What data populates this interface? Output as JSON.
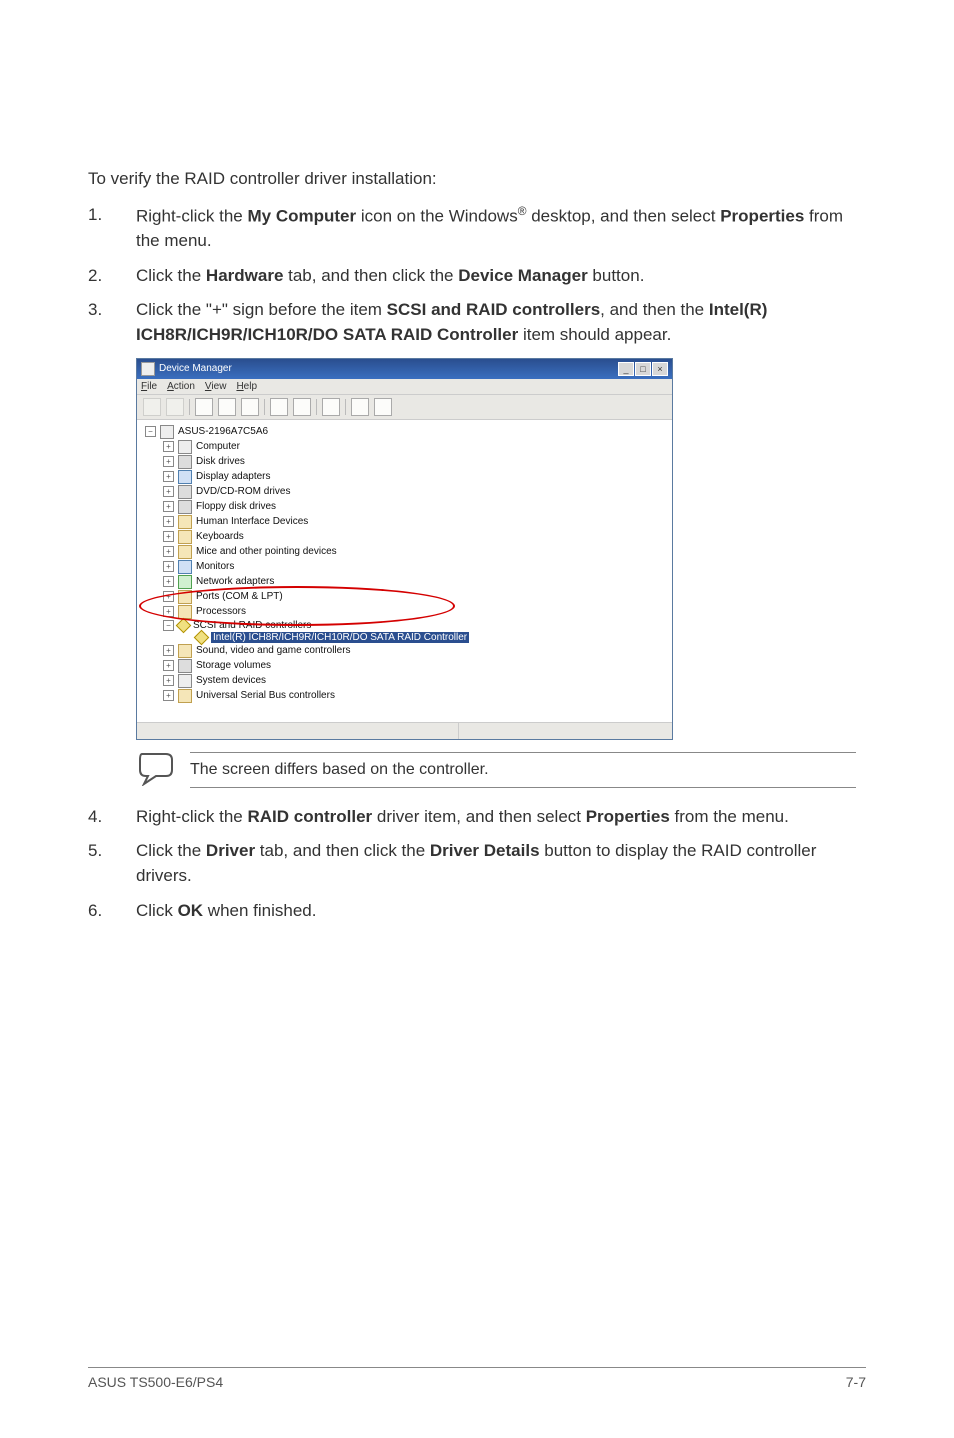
{
  "doc": {
    "intro": "To verify the RAID controller driver installation:",
    "steps": {
      "n1_a": "Right-click the ",
      "n1_b": "My Computer",
      "n1_c": " icon on the Windows",
      "n1_sup": "®",
      "n1_d": " desktop, and then select ",
      "n1_e": "Properties",
      "n1_f": " from the menu.",
      "n2_a": "Click the ",
      "n2_b": "Hardware",
      "n2_c": " tab, and then click the ",
      "n2_d": "Device Manager",
      "n2_e": " button.",
      "n3_a": "Click the \"+\" sign before the item ",
      "n3_b": "SCSI and RAID controllers",
      "n3_c": ", and then the ",
      "n3_d": "Intel(R) ICH8R/ICH9R/ICH10R/DO SATA RAID Controller",
      "n3_e": " item should appear.",
      "n4_a": "Right-click the ",
      "n4_b": "RAID controller",
      "n4_c": " driver item, and then select ",
      "n4_d": "Properties",
      "n4_e": " from the menu.",
      "n5_a": "Click the ",
      "n5_b": "Driver",
      "n5_c": " tab, and then click the ",
      "n5_d": "Driver Details",
      "n5_e": " button to display the RAID controller drivers.",
      "n6_a": "Click ",
      "n6_b": "OK",
      "n6_c": " when finished."
    },
    "note": "The screen differs based on the controller.",
    "footer_left": "ASUS TS500-E6/PS4",
    "footer_right": "7-7",
    "nums": {
      "n1": "1.",
      "n2": "2.",
      "n3": "3.",
      "n4": "4.",
      "n5": "5.",
      "n6": "6."
    }
  },
  "dm": {
    "title": "Device Manager",
    "menu": {
      "file": "File",
      "action": "Action",
      "view": "View",
      "help": "Help"
    },
    "tree": {
      "root": "ASUS-2196A7C5A6",
      "items": [
        "Computer",
        "Disk drives",
        "Display adapters",
        "DVD/CD-ROM drives",
        "Floppy disk drives",
        "Human Interface Devices",
        "Keyboards",
        "Mice and other pointing devices",
        "Monitors",
        "Network adapters",
        "Ports (COM & LPT)",
        "Processors",
        "SCSI and RAID controllers",
        "Sound, video and game controllers",
        "Storage volumes",
        "System devices",
        "Universal Serial Bus controllers"
      ],
      "child_hl": "Intel(R) ICH8R/ICH9R/ICH10R/DO SATA RAID Controller"
    }
  }
}
